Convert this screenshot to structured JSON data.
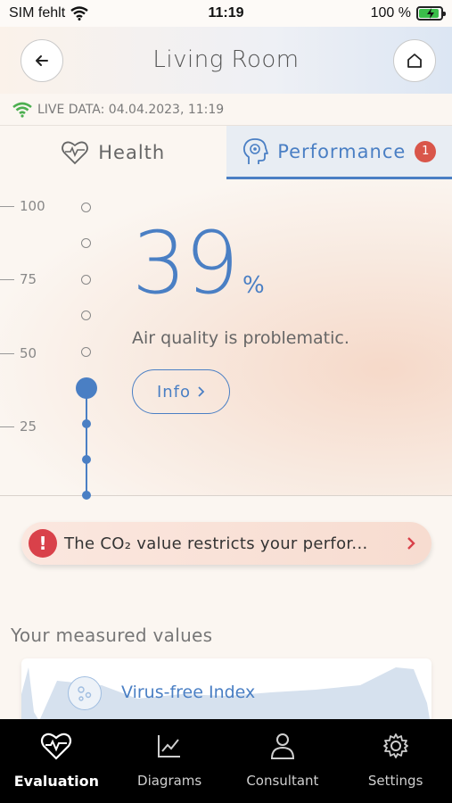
{
  "status_bar": {
    "carrier": "SIM fehlt",
    "time": "11:19",
    "battery": "100 %"
  },
  "header": {
    "title": "Living Room",
    "back_icon": "arrow-left-icon",
    "home_icon": "home-icon"
  },
  "live_data": {
    "label": "LIVE DATA: 04.04.2023, 11:19"
  },
  "tabs": [
    {
      "label": "Health",
      "icon": "heart-pulse-icon",
      "active": false
    },
    {
      "label": "Performance",
      "icon": "head-icon",
      "active": true,
      "badge": "1"
    }
  ],
  "gauge": {
    "value": "39",
    "unit": "%",
    "scale": [
      "100",
      "75",
      "50",
      "25"
    ],
    "status_text": "Air quality is problematic.",
    "info_label": "Info",
    "accent_color": "#4a7fc4"
  },
  "alert": {
    "icon": "!",
    "text": "The CO₂ value restricts your perfor...",
    "color": "#d9414a"
  },
  "measured": {
    "title": "Your measured values",
    "cards": [
      {
        "title": "Virus-free Index",
        "icon": "virus-icon"
      }
    ]
  },
  "tab_bar": [
    {
      "label": "Evaluation",
      "icon": "heart-pulse-icon",
      "active": true
    },
    {
      "label": "Diagrams",
      "icon": "chart-icon",
      "active": false
    },
    {
      "label": "Consultant",
      "icon": "person-icon",
      "active": false
    },
    {
      "label": "Settings",
      "icon": "gear-icon",
      "active": false
    }
  ]
}
